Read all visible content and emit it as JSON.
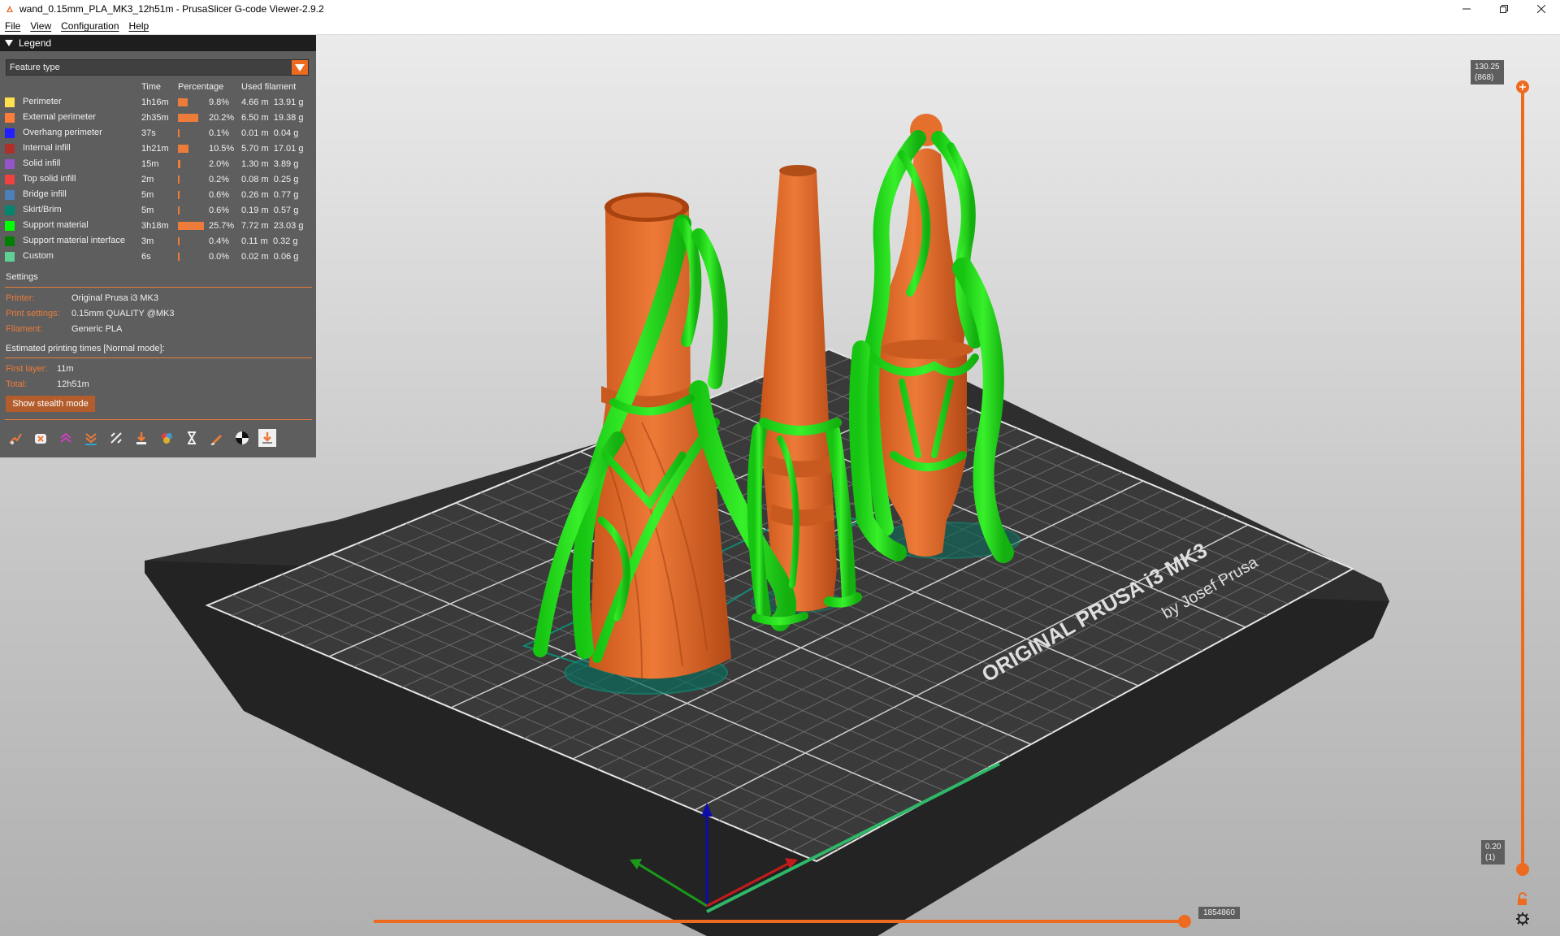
{
  "window": {
    "title": "wand_0.15mm_PLA_MK3_12h51m - PrusaSlicer G-code Viewer-2.9.2",
    "controls": [
      "minimize",
      "maximize",
      "close"
    ]
  },
  "menu": [
    "File",
    "View",
    "Configuration",
    "Help"
  ],
  "legend": {
    "header": "Legend",
    "view_type": "Feature type",
    "columns": [
      "",
      "Time",
      "Percentage",
      "Used filament"
    ],
    "rows": [
      {
        "name": "Perimeter",
        "color": "#ffe14d",
        "time": "1h16m",
        "pct": 9.8,
        "pct_label": "9.8%",
        "length": "4.66 m",
        "weight": "13.91 g"
      },
      {
        "name": "External perimeter",
        "color": "#ff7d38",
        "time": "2h35m",
        "pct": 20.2,
        "pct_label": "20.2%",
        "length": "6.50 m",
        "weight": "19.38 g"
      },
      {
        "name": "Overhang perimeter",
        "color": "#1f1fff",
        "time": "37s",
        "pct": 0.1,
        "pct_label": "0.1%",
        "length": "0.01 m",
        "weight": "0.04 g"
      },
      {
        "name": "Internal infill",
        "color": "#b03029",
        "time": "1h21m",
        "pct": 10.5,
        "pct_label": "10.5%",
        "length": "5.70 m",
        "weight": "17.01 g"
      },
      {
        "name": "Solid infill",
        "color": "#9654cc",
        "time": "15m",
        "pct": 2.0,
        "pct_label": "2.0%",
        "length": "1.30 m",
        "weight": "3.89 g"
      },
      {
        "name": "Top solid infill",
        "color": "#f04040",
        "time": "2m",
        "pct": 0.2,
        "pct_label": "0.2%",
        "length": "0.08 m",
        "weight": "0.25 g"
      },
      {
        "name": "Bridge infill",
        "color": "#4d80ba",
        "time": "5m",
        "pct": 0.6,
        "pct_label": "0.6%",
        "length": "0.26 m",
        "weight": "0.77 g"
      },
      {
        "name": "Skirt/Brim",
        "color": "#00876e",
        "time": "5m",
        "pct": 0.6,
        "pct_label": "0.6%",
        "length": "0.19 m",
        "weight": "0.57 g"
      },
      {
        "name": "Support material",
        "color": "#00ff00",
        "time": "3h18m",
        "pct": 25.7,
        "pct_label": "25.7%",
        "length": "7.72 m",
        "weight": "23.03 g"
      },
      {
        "name": "Support material interface",
        "color": "#008000",
        "time": "3m",
        "pct": 0.4,
        "pct_label": "0.4%",
        "length": "0.11 m",
        "weight": "0.32 g"
      },
      {
        "name": "Custom",
        "color": "#5ed194",
        "time": "6s",
        "pct": 0.0,
        "pct_label": "0.0%",
        "length": "0.02 m",
        "weight": "0.06 g"
      }
    ],
    "settings": {
      "heading": "Settings",
      "printer_label": "Printer:",
      "printer_value": "Original Prusa i3 MK3",
      "print_label": "Print settings:",
      "print_value": "0.15mm QUALITY @MK3",
      "filament_label": "Filament:",
      "filament_value": "Generic PLA"
    },
    "times": {
      "heading": "Estimated printing times [Normal mode]:",
      "first_layer_label": "First layer:",
      "first_layer_value": "11m",
      "total_label": "Total:",
      "total_value": "12h51m"
    },
    "stealth_button": "Show stealth mode",
    "toolbar_icons": [
      "travel-icon",
      "wipe-icon",
      "retractions-icon",
      "deretractions-icon",
      "seams-icon",
      "tool-changes-icon",
      "color-changes-icon",
      "pause-prints-icon",
      "custom-gcodes-icon",
      "center-of-gravity-icon",
      "shells-icon"
    ]
  },
  "vertical_slider": {
    "top_label": "130.25\n(868)",
    "bottom_label": "0.20\n(1)"
  },
  "horizontal_slider": {
    "value_label": "1854860"
  },
  "bed": {
    "text_line1": "ORIGINAL PRUSA i3 MK3",
    "text_line2": "by Josef Prusa"
  },
  "colors": {
    "accent": "#ed6b21",
    "model": "#e06c2b",
    "support": "#22e01c",
    "panel": "#5e5e5e"
  }
}
